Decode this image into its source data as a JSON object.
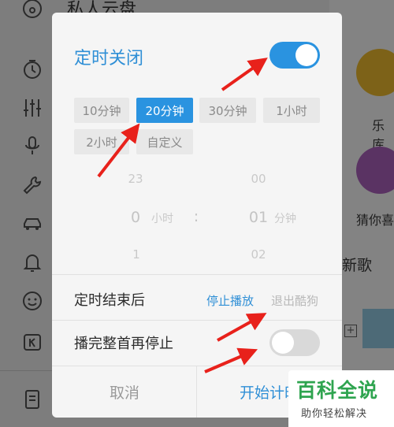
{
  "background": {
    "title": "私人云盘",
    "right_labels": [
      "乐库",
      "猜你喜"
    ],
    "right_section": "新歌",
    "sidebar_icons": [
      "disc-icon",
      "timer-icon",
      "equalizer-icon",
      "mic-icon",
      "wrench-icon",
      "car-icon",
      "bell-icon",
      "smile-icon",
      "k-icon",
      "document-icon"
    ]
  },
  "dialog": {
    "title": "定时关闭",
    "timer_enabled": true,
    "presets": [
      {
        "label": "10分钟",
        "selected": false
      },
      {
        "label": "20分钟",
        "selected": true
      },
      {
        "label": "30分钟",
        "selected": false
      },
      {
        "label": "1小时",
        "selected": false
      },
      {
        "label": "2小时",
        "selected": false
      },
      {
        "label": "自定义",
        "selected": false
      }
    ],
    "picker": {
      "hours_prev": "23",
      "hours_current": "0",
      "hours_next": "1",
      "hours_unit": "小时",
      "colon": ":",
      "minutes_prev": "00",
      "minutes_current": "01",
      "minutes_next": "02",
      "minutes_unit": "分钟"
    },
    "after_label": "定时结束后",
    "after_options": {
      "stop": "停止播放",
      "exit": "退出酷狗"
    },
    "finish_song_label": "播完整首再停止",
    "finish_song_enabled": false,
    "cancel_label": "取消",
    "start_label": "开始计时"
  },
  "watermark": {
    "title": "百科全说",
    "subtitle": "助你轻松解决"
  },
  "colors": {
    "accent": "#2a93e0",
    "arrow": "#e8211b",
    "watermark": "#2ea44f"
  }
}
